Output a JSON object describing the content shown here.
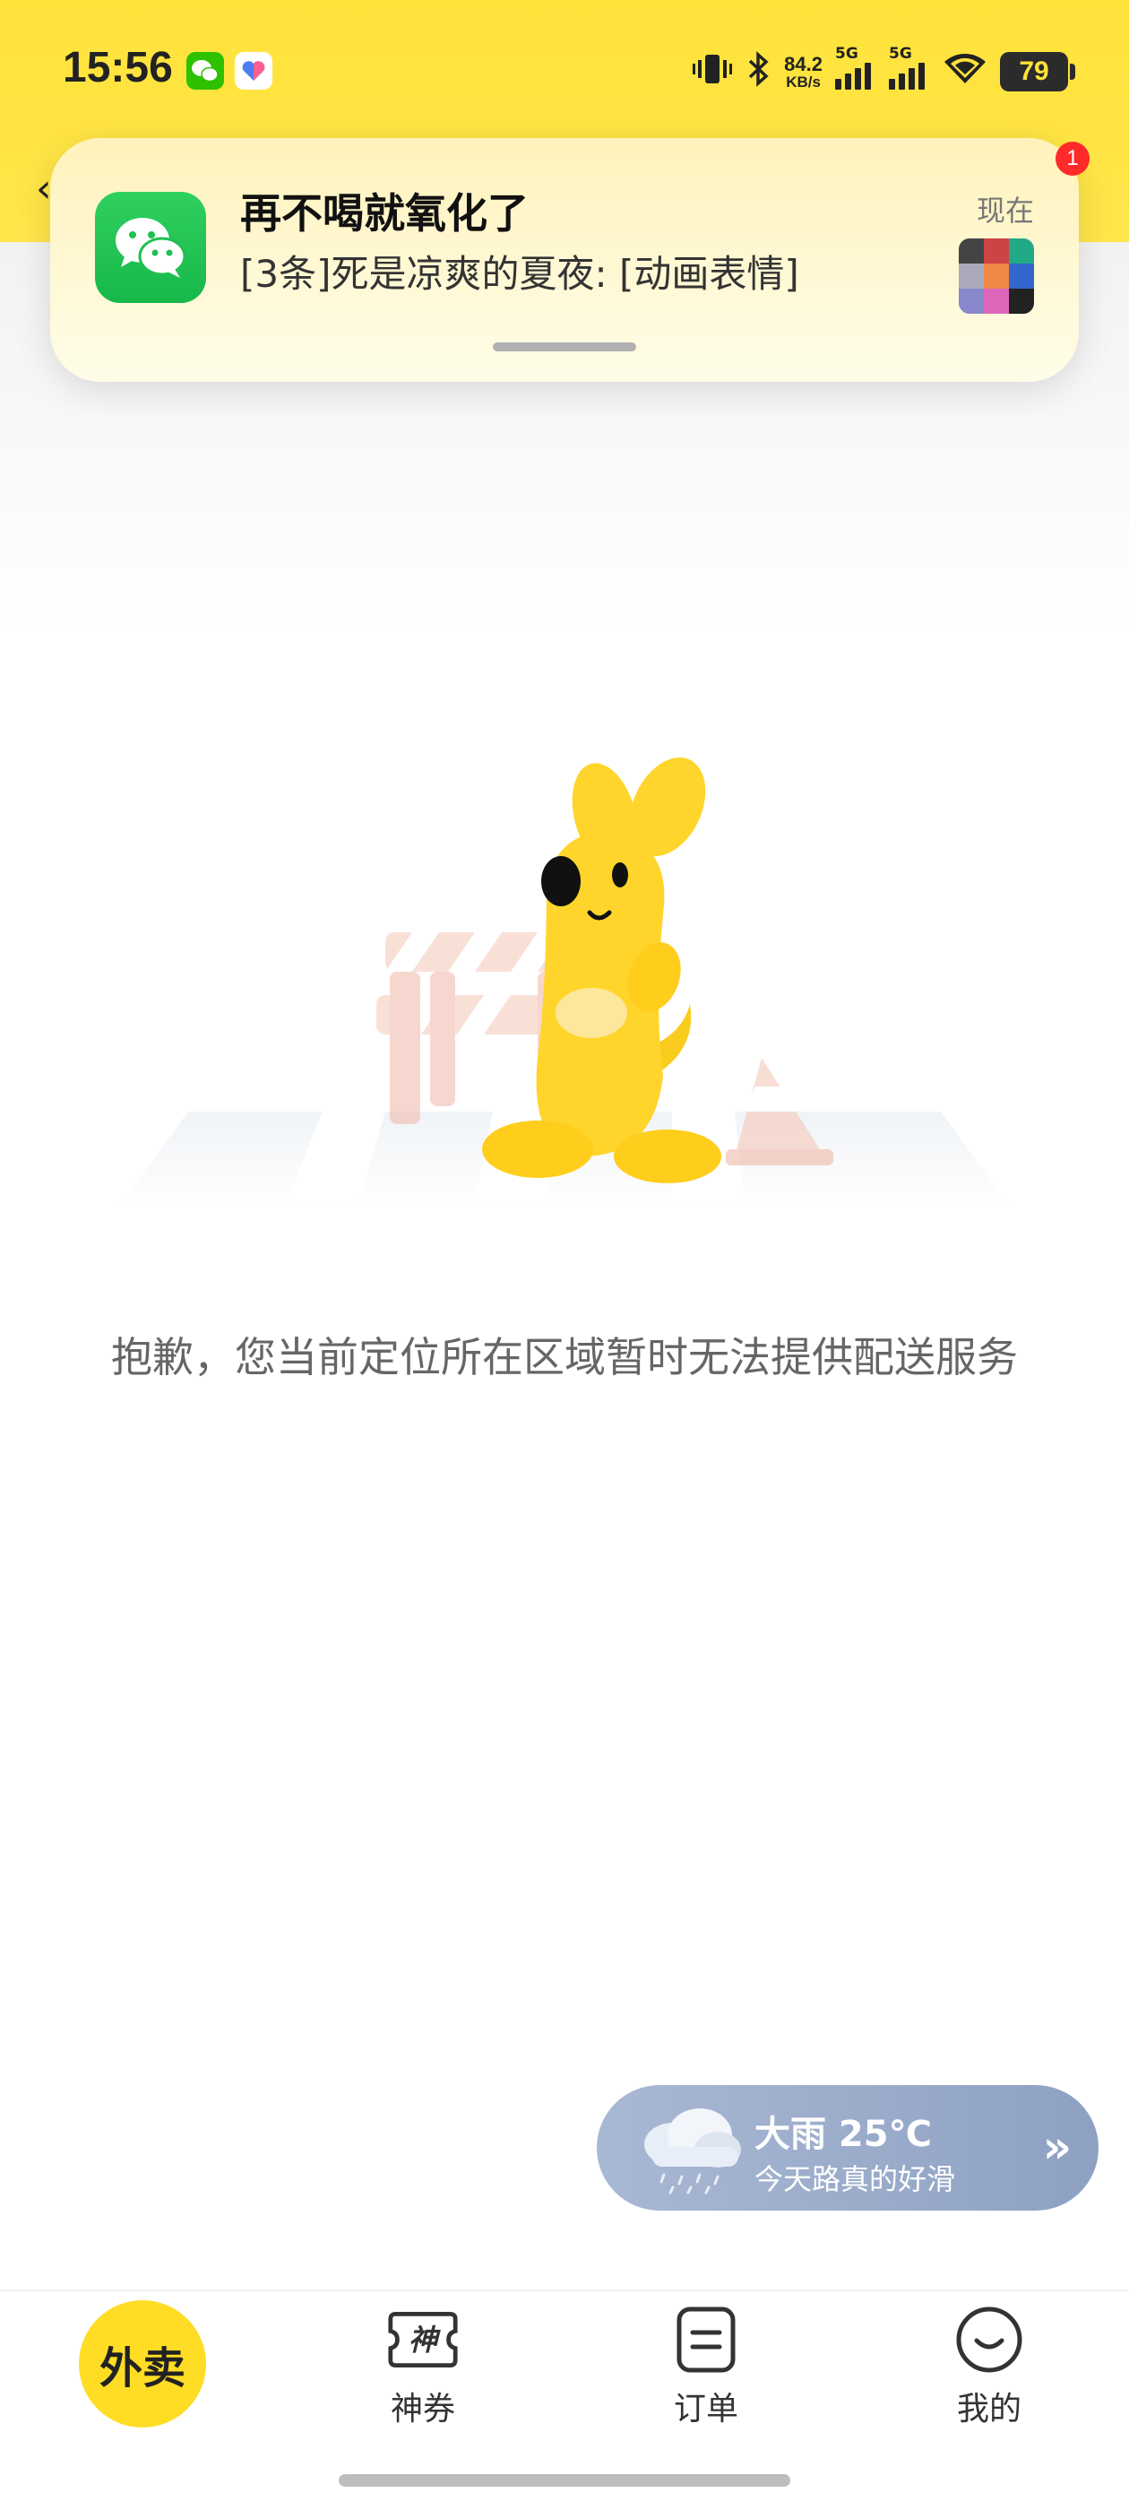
{
  "status_bar": {
    "time": "15:56",
    "net_speed_value": "84.2",
    "net_speed_unit": "KB/s",
    "signal1_label": "5G",
    "signal2_label": "5G",
    "battery": "79"
  },
  "notification": {
    "app_icon": "wechat-icon",
    "title": "再不喝就氧化了",
    "body": "[3条]死是凉爽的夏夜: [动画表情]",
    "time": "现在",
    "badge_count": "1"
  },
  "main": {
    "message": "抱歉，您当前定位所在区域暂时无法提供配送服务"
  },
  "weather": {
    "title": "大雨 25℃",
    "subtitle": "今天路真的好滑",
    "icon": "rain-cloud-icon",
    "arrow": "»"
  },
  "bottom_nav": {
    "home_label": "外卖",
    "items": [
      {
        "label": "神券",
        "icon": "coupon-icon"
      },
      {
        "label": "订单",
        "icon": "order-icon"
      },
      {
        "label": "我的",
        "icon": "smile-icon"
      }
    ]
  },
  "colors": {
    "brand_yellow": "#ffdd25",
    "wechat_green": "#1fbf50",
    "weather_blue": "#8ea1c3"
  }
}
